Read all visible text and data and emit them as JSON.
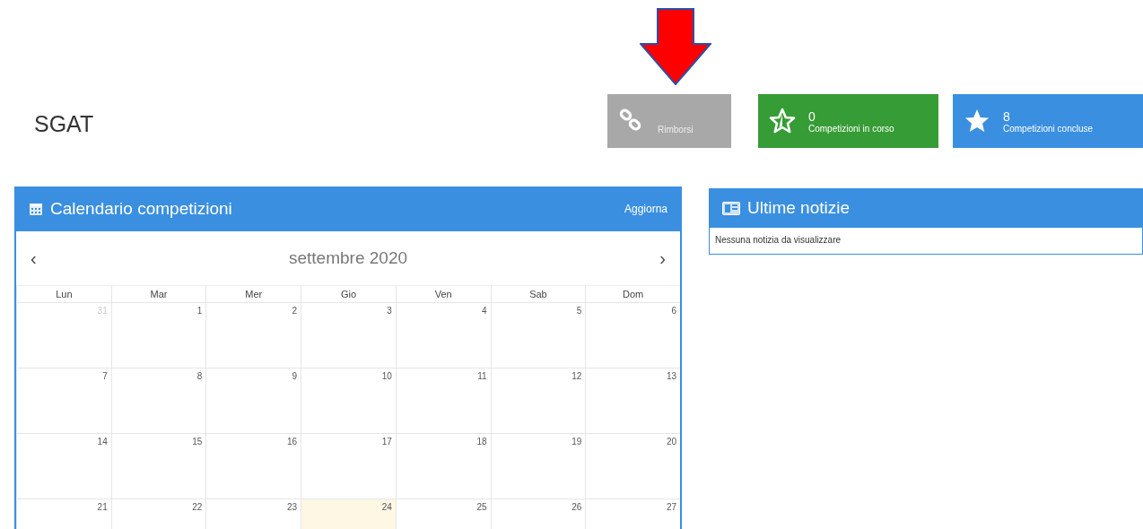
{
  "header": {
    "title": "SGAT"
  },
  "tiles": [
    {
      "kind": "link",
      "label": "Rimborsi",
      "color": "#a8a8a8",
      "annotated": true
    },
    {
      "kind": "running",
      "count": "0",
      "label": "Competizioni in corso",
      "color": "#369c35",
      "annotated": false
    },
    {
      "kind": "finished",
      "count": "8",
      "label": "Competizioni concluse",
      "color": "#3a8fe0",
      "annotated": false
    }
  ],
  "calendar": {
    "title": "Calendario competizioni",
    "refresh": "Aggiorna",
    "prev": "‹",
    "next": "›",
    "month": "settembre 2020",
    "weekdays": [
      "Lun",
      "Mar",
      "Mer",
      "Gio",
      "Ven",
      "Sab",
      "Dom"
    ],
    "weeks": [
      [
        {
          "day": "31",
          "other_month": true,
          "today": false
        },
        {
          "day": "1",
          "other_month": false,
          "today": false
        },
        {
          "day": "2",
          "other_month": false,
          "today": false
        },
        {
          "day": "3",
          "other_month": false,
          "today": false
        },
        {
          "day": "4",
          "other_month": false,
          "today": false
        },
        {
          "day": "5",
          "other_month": false,
          "today": false
        },
        {
          "day": "6",
          "other_month": false,
          "today": false
        }
      ],
      [
        {
          "day": "7",
          "other_month": false,
          "today": false
        },
        {
          "day": "8",
          "other_month": false,
          "today": false
        },
        {
          "day": "9",
          "other_month": false,
          "today": false
        },
        {
          "day": "10",
          "other_month": false,
          "today": false
        },
        {
          "day": "11",
          "other_month": false,
          "today": false
        },
        {
          "day": "12",
          "other_month": false,
          "today": false
        },
        {
          "day": "13",
          "other_month": false,
          "today": false
        }
      ],
      [
        {
          "day": "14",
          "other_month": false,
          "today": false
        },
        {
          "day": "15",
          "other_month": false,
          "today": false
        },
        {
          "day": "16",
          "other_month": false,
          "today": false
        },
        {
          "day": "17",
          "other_month": false,
          "today": false
        },
        {
          "day": "18",
          "other_month": false,
          "today": false
        },
        {
          "day": "19",
          "other_month": false,
          "today": false
        },
        {
          "day": "20",
          "other_month": false,
          "today": false
        }
      ],
      [
        {
          "day": "21",
          "other_month": false,
          "today": false
        },
        {
          "day": "22",
          "other_month": false,
          "today": false
        },
        {
          "day": "23",
          "other_month": false,
          "today": false
        },
        {
          "day": "24",
          "other_month": false,
          "today": true
        },
        {
          "day": "25",
          "other_month": false,
          "today": false
        },
        {
          "day": "26",
          "other_month": false,
          "today": false
        },
        {
          "day": "27",
          "other_month": false,
          "today": false
        }
      ]
    ]
  },
  "news": {
    "title": "Ultime notizie",
    "empty_message": "Nessuna notizia da visualizzare"
  }
}
